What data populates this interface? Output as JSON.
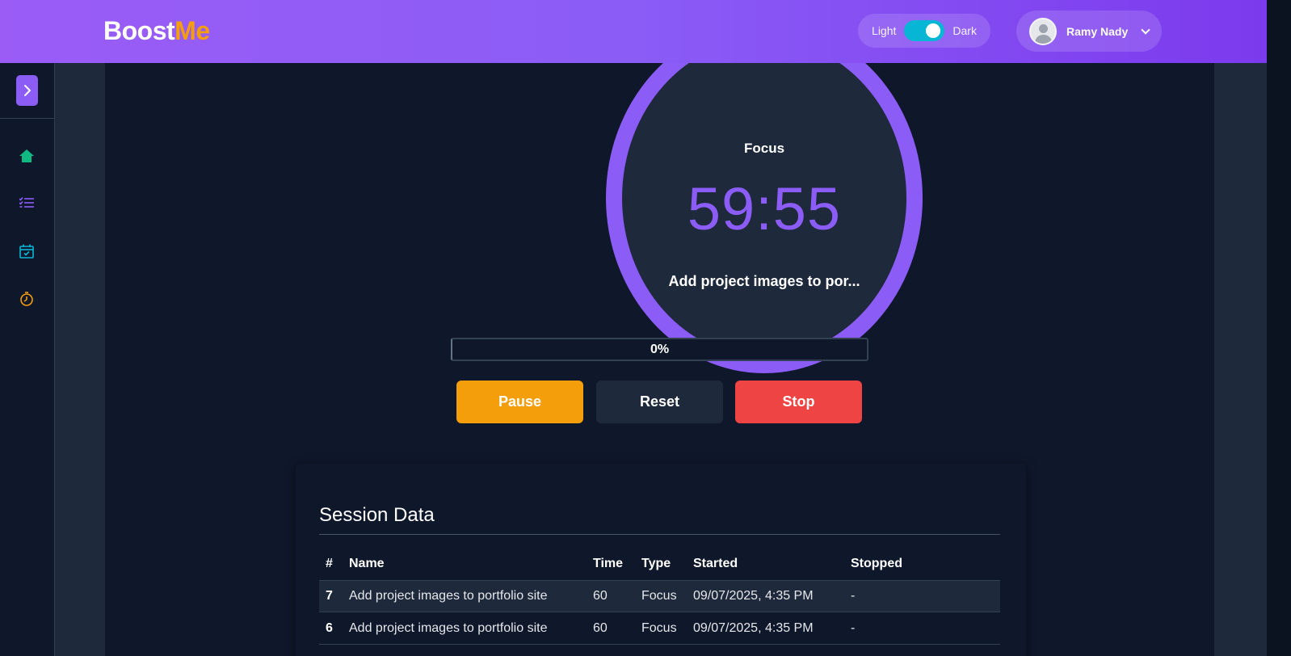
{
  "header": {
    "logo_part1": "Boost",
    "logo_part2": "Me",
    "theme_light_label": "Light",
    "theme_dark_label": "Dark",
    "theme_dark_enabled": true,
    "user_name": "Ramy Nady"
  },
  "sidebar": {
    "items": [
      {
        "icon": "home-icon",
        "color": "#10b981"
      },
      {
        "icon": "task-list-icon",
        "color": "#8b5cf6"
      },
      {
        "icon": "calendar-check-icon",
        "color": "#06b6d4"
      },
      {
        "icon": "stopwatch-icon",
        "color": "#f59e0b"
      }
    ]
  },
  "timer": {
    "mode": "Focus",
    "time": "59:55",
    "task": "Add project images to por...",
    "progress_text": "0%",
    "progress_value": 0
  },
  "controls": {
    "pause_label": "Pause",
    "reset_label": "Reset",
    "stop_label": "Stop"
  },
  "session": {
    "title": "Session Data",
    "columns": [
      "#",
      "Name",
      "Time",
      "Type",
      "Started",
      "Stopped"
    ],
    "rows": [
      {
        "num": "7",
        "name": "Add project images to portfolio site",
        "time": "60",
        "type": "Focus",
        "started": "09/07/2025, 4:35 PM",
        "stopped": "-"
      },
      {
        "num": "6",
        "name": "Add project images to portfolio site",
        "time": "60",
        "type": "Focus",
        "started": "09/07/2025, 4:35 PM",
        "stopped": "-"
      }
    ]
  },
  "colors": {
    "accent": "#8b5cf6",
    "pause": "#f59e0b",
    "stop": "#ef4444",
    "logo_accent": "#f59e0b"
  }
}
